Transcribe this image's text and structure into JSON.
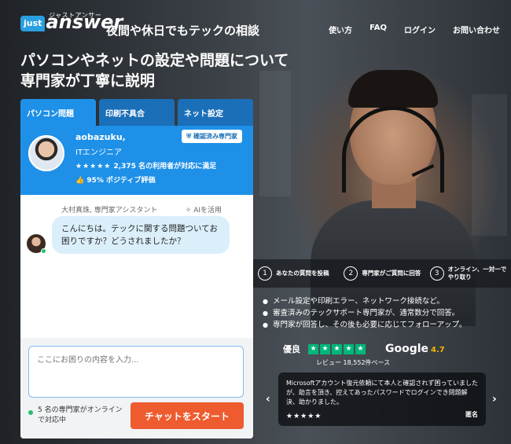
{
  "header": {
    "logo_small": "just",
    "logo_main": "answer",
    "logo_kana": "ジャストアンサー",
    "tagline": "夜間や休日でもテックの相談",
    "nav": [
      "使い方",
      "FAQ",
      "ログイン",
      "お問い合わせ"
    ]
  },
  "hero": {
    "title": "パソコンやネットの設定や問題について専門家が丁寧に説明"
  },
  "chat": {
    "tabs": [
      "パソコン問題",
      "印刷不具合",
      "ネット設定"
    ],
    "expert": {
      "name": "aobazuku,",
      "role": "ITエンジニア",
      "verified": "確認済み専門家",
      "stars": "★★★★★",
      "rating_text": "2,375 名の利用者が対応に満足",
      "positive": "95% ポジティブ評価"
    },
    "assistant_label": "大村真珠, 専門家アシスタント",
    "ai_label": "AIを活用",
    "message": "こんにちは。テックに関する問題ついてお困りですか？どうされましたか？",
    "input_placeholder": "ここにお困りの内容を入力...",
    "online_text": "5 名の専門家がオンラインで対応中",
    "start_button": "チャットをスタート"
  },
  "steps": [
    {
      "num": "1",
      "label": "あなたの質問を投稿"
    },
    {
      "num": "2",
      "label": "専門家がご質問に回答"
    },
    {
      "num": "3",
      "label": "オンライン、一対一でやり取り"
    }
  ],
  "features": [
    "メール設定や印刷エラー、ネットワーク接続など。",
    "審査済みのテックサポート専門家が、通常数分で回答。",
    "専門家が回答し、その後も必要に応じてフォローアップ。"
  ],
  "reviews": {
    "label": "優良",
    "count": "レビュー 18,552件ベース",
    "google_word": "Google",
    "google_score": "4.7",
    "testimonial_text": "Microsoftアカウント復元依頼にて本人と確認されず困っていましたが、助言を頂き、控えてあったパスワードでログインでき問題解決、助かりました。",
    "testimonial_stars": "★★★★★",
    "testimonial_author": "匿名"
  },
  "colors": {
    "brand_blue": "#1e90e8",
    "cta_orange": "#ee5b2e",
    "trustpilot_green": "#00b67a",
    "online_green": "#25c06b"
  }
}
